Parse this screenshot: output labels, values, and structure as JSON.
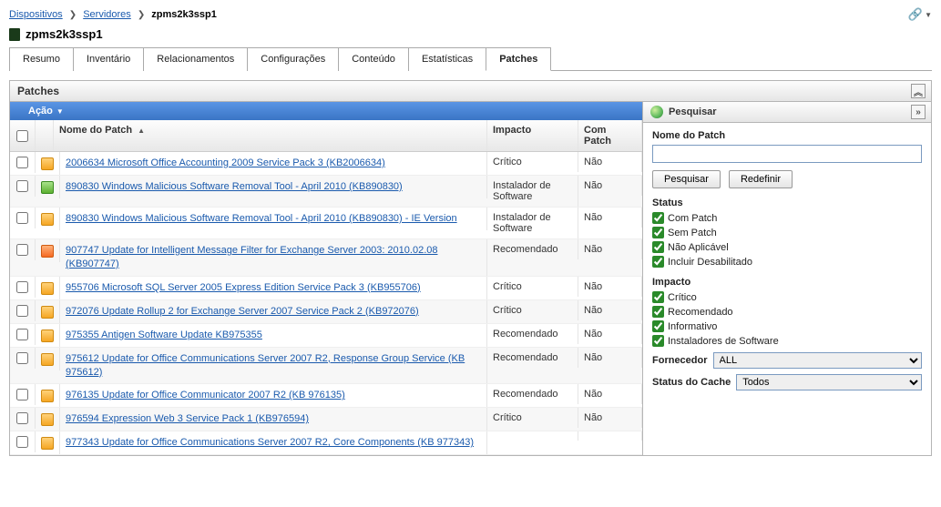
{
  "breadcrumb": {
    "dispositivos": "Dispositivos",
    "servidores": "Servidores",
    "current": "zpms2k3ssp1"
  },
  "device_name": "zpms2k3ssp1",
  "tabs": {
    "resumo": "Resumo",
    "inventario": "Inventário",
    "relacionamentos": "Relacionamentos",
    "configuracoes": "Configurações",
    "conteudo": "Conteúdo",
    "estatisticas": "Estatísticas",
    "patches": "Patches"
  },
  "panel": {
    "title": "Patches",
    "action_label": "Ação"
  },
  "columns": {
    "name": "Nome do Patch",
    "impact": "Impacto",
    "patched": "Com Patch"
  },
  "rows": [
    {
      "icon": "orange",
      "name": "2006634 Microsoft Office Accounting 2009 Service Pack 3 (KB2006634)",
      "impact": "Crítico",
      "patched": "Não"
    },
    {
      "icon": "green",
      "name": "890830 Windows Malicious Software Removal Tool - April 2010 (KB890830)",
      "impact": "Instalador de Software",
      "patched": "Não"
    },
    {
      "icon": "orange",
      "name": "890830 Windows Malicious Software Removal Tool - April 2010 (KB890830) - IE Version",
      "impact": "Instalador de Software",
      "patched": "Não"
    },
    {
      "icon": "redorange",
      "name": "907747 Update for Intelligent Message Filter for Exchange Server 2003: 2010.02.08 (KB907747)",
      "impact": "Recomendado",
      "patched": "Não"
    },
    {
      "icon": "orange",
      "name": "955706 Microsoft SQL Server 2005 Express Edition Service Pack 3 (KB955706)",
      "impact": "Crítico",
      "patched": "Não"
    },
    {
      "icon": "orange",
      "name": "972076 Update Rollup 2 for Exchange Server 2007 Service Pack 2 (KB972076)",
      "impact": "Crítico",
      "patched": "Não"
    },
    {
      "icon": "orange",
      "name": "975355 Antigen Software Update KB975355",
      "impact": "Recomendado",
      "patched": "Não"
    },
    {
      "icon": "orange",
      "name": "975612 Update for Office Communications Server 2007 R2, Response Group Service (KB 975612)",
      "impact": "Recomendado",
      "patched": "Não"
    },
    {
      "icon": "orange",
      "name": "976135 Update for Office Communicator 2007 R2 (KB 976135)",
      "impact": "Recomendado",
      "patched": "Não"
    },
    {
      "icon": "orange",
      "name": "976594 Expression Web 3 Service Pack 1 (KB976594)",
      "impact": "Crítico",
      "patched": "Não"
    },
    {
      "icon": "orange",
      "name": "977343 Update for Office Communications Server 2007 R2, Core Components (KB 977343)",
      "impact": "",
      "patched": ""
    }
  ],
  "search": {
    "title": "Pesquisar",
    "name_label": "Nome do Patch",
    "search_btn": "Pesquisar",
    "reset_btn": "Redefinir",
    "status_h": "Status",
    "status": {
      "compatch": "Com Patch",
      "sempatch": "Sem Patch",
      "naoaplicavel": "Não Aplicável",
      "incluirdesab": "Incluir Desabilitado"
    },
    "impact_h": "Impacto",
    "impact": {
      "critico": "Crítico",
      "recomendado": "Recomendado",
      "informativo": "Informativo",
      "instaladores": "Instaladores de Software"
    },
    "vendor_label": "Fornecedor",
    "vendor_value": "ALL",
    "cache_label": "Status do Cache",
    "cache_value": "Todos"
  }
}
